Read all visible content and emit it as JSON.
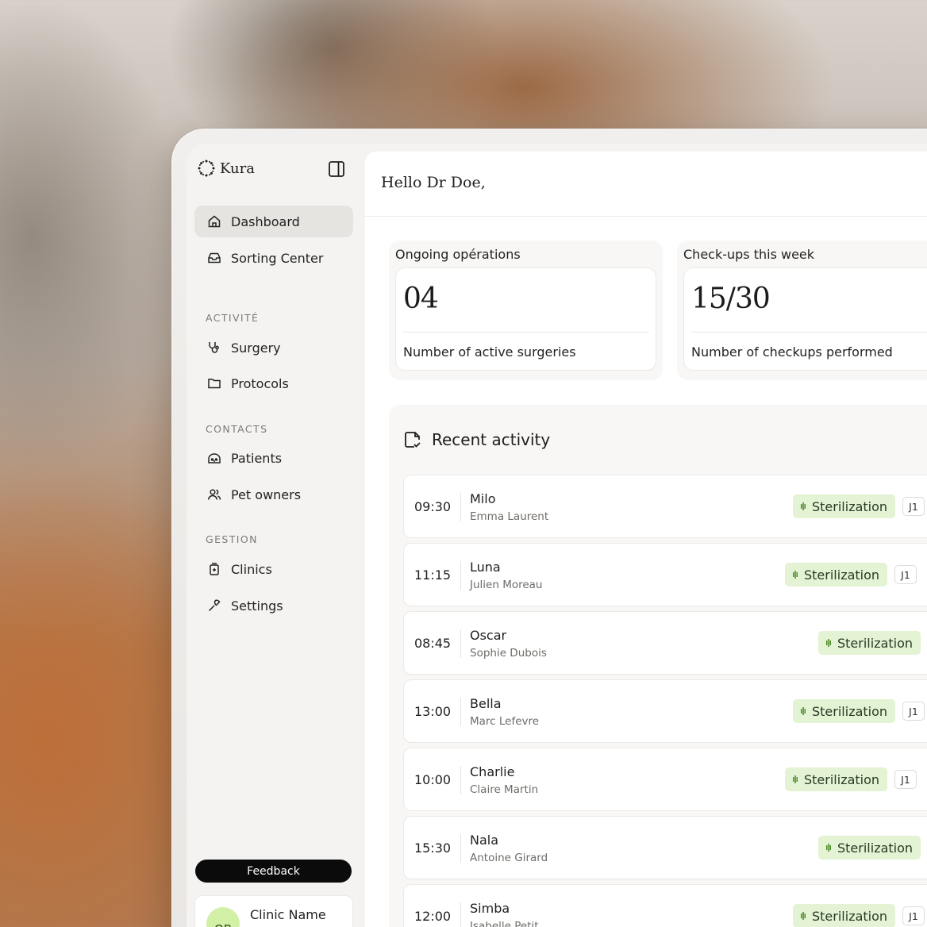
{
  "app": {
    "name": "Kura"
  },
  "sidebar": {
    "nav_top": [
      {
        "label": "Dashboard",
        "icon": "home-icon",
        "active": true
      },
      {
        "label": "Sorting Center",
        "icon": "inbox-icon",
        "active": false
      }
    ],
    "sections": [
      {
        "title": "ACTIVITÉ",
        "items": [
          {
            "label": "Surgery",
            "icon": "stethoscope-icon"
          },
          {
            "label": "Protocols",
            "icon": "folder-icon"
          }
        ]
      },
      {
        "title": "CONTACTS",
        "items": [
          {
            "label": "Patients",
            "icon": "pet-icon"
          },
          {
            "label": "Pet owners",
            "icon": "users-icon"
          }
        ]
      },
      {
        "title": "GESTION",
        "items": [
          {
            "label": "Clinics",
            "icon": "clinic-icon"
          },
          {
            "label": "Settings",
            "icon": "wrench-icon"
          }
        ]
      }
    ],
    "feedback_label": "Feedback",
    "clinic": {
      "avatar_initials": "QB",
      "name": "Clinic Name"
    }
  },
  "main": {
    "greeting": "Hello Dr Doe,",
    "stats": [
      {
        "title": "Ongoing opérations",
        "value": "04",
        "description": "Number of active surgeries"
      },
      {
        "title": "Check-ups this week",
        "value": "15/30",
        "description": "Number of checkups performed"
      }
    ],
    "activity": {
      "title": "Recent activity",
      "rows": [
        {
          "time": "09:30",
          "pet": "Milo",
          "owner": "Emma Laurent",
          "tag": "Sterilization",
          "badge": "J1"
        },
        {
          "time": "11:15",
          "pet": "Luna",
          "owner": "Julien Moreau",
          "tag": "Sterilization",
          "badge": "J1"
        },
        {
          "time": "08:45",
          "pet": "Oscar",
          "owner": "Sophie Dubois",
          "tag": "Sterilization",
          "badge": ""
        },
        {
          "time": "13:00",
          "pet": "Bella",
          "owner": "Marc Lefevre",
          "tag": "Sterilization",
          "badge": "J1"
        },
        {
          "time": "10:00",
          "pet": "Charlie",
          "owner": "Claire Martin",
          "tag": "Sterilization",
          "badge": "J1"
        },
        {
          "time": "15:30",
          "pet": "Nala",
          "owner": "Antoine Girard",
          "tag": "Sterilization",
          "badge": ""
        },
        {
          "time": "12:00",
          "pet": "Simba",
          "owner": "Isabelle Petit",
          "tag": "Sterilization",
          "badge": "J1"
        }
      ]
    }
  },
  "colors": {
    "tag_bg": "#e3f3d4",
    "tag_accent": "#4f8a2a",
    "avatar_bg": "#d2f0a6",
    "feedback_bg": "#0b0b0b"
  }
}
